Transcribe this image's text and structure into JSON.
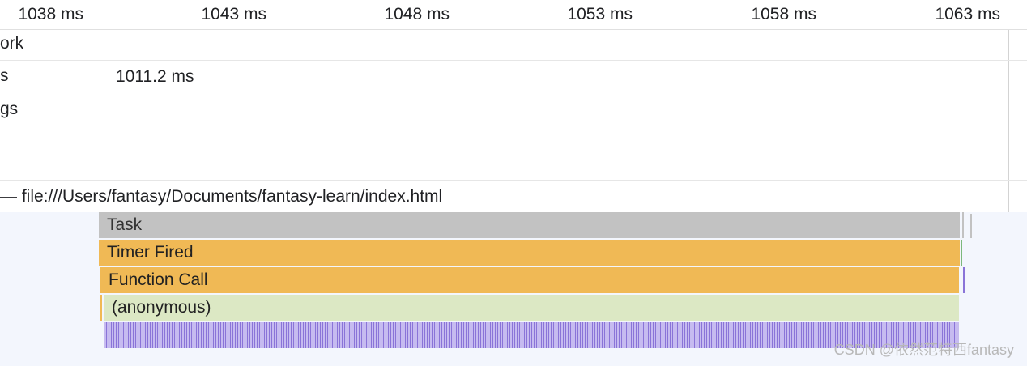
{
  "ruler": {
    "ticks": [
      "1038 ms",
      "1043 ms",
      "1048 ms",
      "1053 ms",
      "1058 ms",
      "1063 ms"
    ]
  },
  "tracks": {
    "network_label": "ork",
    "frames_label": "s",
    "frames_value": "1011.2 ms",
    "timings_label": "gs"
  },
  "main_thread": {
    "header": "— file:///Users/fantasy/Documents/fantasy-learn/index.html"
  },
  "flame": {
    "task": "Task",
    "timer_fired": "Timer Fired",
    "function_call": "Function Call",
    "anonymous": "(anonymous)"
  },
  "colors": {
    "task": "#c2c2c2",
    "scripting": "#f0b955",
    "js_frame": "#dce8c4",
    "microtask": "#8a74d8",
    "flame_background": "#f3f6fd"
  },
  "watermark": "CSDN @依然范特西fantasy"
}
